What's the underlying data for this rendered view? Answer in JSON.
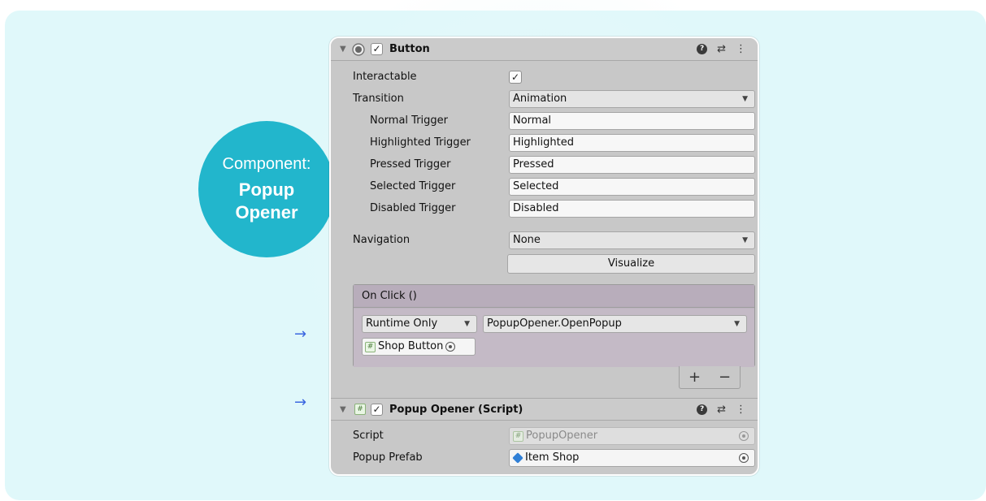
{
  "callout": {
    "label": "Component:",
    "name_line1": "Popup",
    "name_line2": "Opener"
  },
  "arrows": [
    "→",
    "→"
  ],
  "button_component": {
    "title": "Button",
    "enabled": true,
    "fields": {
      "interactable": {
        "label": "Interactable",
        "checked": true,
        "check_glyph": "✓"
      },
      "transition": {
        "label": "Transition",
        "value": "Animation"
      },
      "normal_trigger": {
        "label": "Normal Trigger",
        "value": "Normal"
      },
      "highlighted_trigger": {
        "label": "Highlighted Trigger",
        "value": "Highlighted"
      },
      "pressed_trigger": {
        "label": "Pressed Trigger",
        "value": "Pressed"
      },
      "selected_trigger": {
        "label": "Selected Trigger",
        "value": "Selected"
      },
      "disabled_trigger": {
        "label": "Disabled Trigger",
        "value": "Disabled"
      },
      "navigation": {
        "label": "Navigation",
        "value": "None"
      }
    },
    "visualize_label": "Visualize",
    "on_click": {
      "header": "On Click ()",
      "call_state": "Runtime Only",
      "function": "PopupOpener.OpenPopup",
      "target_object": "Shop Button",
      "add_label": "+",
      "remove_label": "−"
    }
  },
  "script_component": {
    "title": "Popup Opener (Script)",
    "enabled": true,
    "fields": {
      "script": {
        "label": "Script",
        "value": "PopupOpener"
      },
      "popup_prefab": {
        "label": "Popup Prefab",
        "value": "Item Shop"
      }
    }
  },
  "header_icons": {
    "help": "?",
    "presets": "⇄",
    "menu": "⋮"
  },
  "colors": {
    "background": "#e0f8fa",
    "callout": "#22b6cc",
    "arrow": "#3a66e0",
    "inspector": "#c8c8c8",
    "on_click_panel": "#c4bac6"
  }
}
